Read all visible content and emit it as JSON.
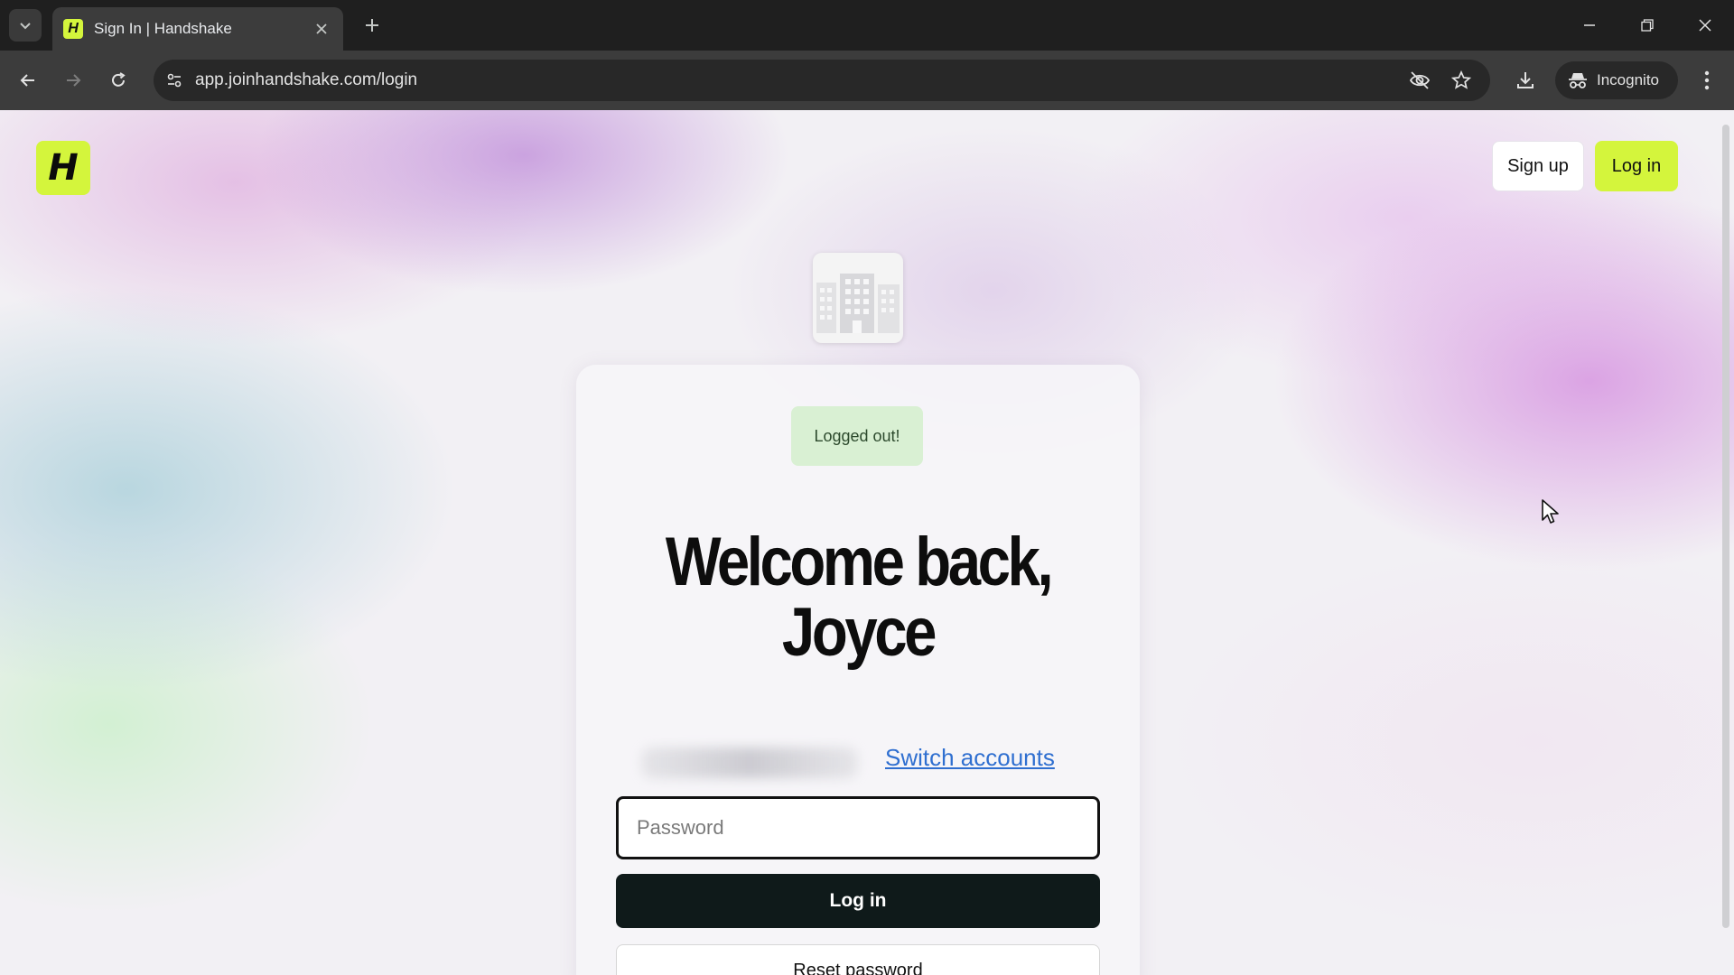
{
  "browser": {
    "tab_title": "Sign In | Handshake",
    "tab_favicon_letter": "H",
    "url": "app.joinhandshake.com/login",
    "incognito_label": "Incognito"
  },
  "header": {
    "logo_letter": "H",
    "signup_label": "Sign up",
    "login_label": "Log in"
  },
  "card": {
    "toast": "Logged out!",
    "welcome_line1": "Welcome back,",
    "welcome_line2": "Joyce",
    "switch_accounts": "Switch accounts",
    "password_placeholder": "Password",
    "login_button": "Log in",
    "reset_button": "Reset password"
  },
  "colors": {
    "brand_lime": "#d4f53c",
    "primary_button": "#0f1a1a",
    "link": "#2f6fd0",
    "toast_bg": "#d9f0d3"
  },
  "icons": [
    "tab-search-icon",
    "close-icon",
    "plus-icon",
    "minimize-icon",
    "restore-icon",
    "window-close-icon",
    "back-icon",
    "forward-icon",
    "reload-icon",
    "site-settings-icon",
    "eye-off-icon",
    "star-icon",
    "download-icon",
    "incognito-icon",
    "more-vert-icon",
    "building-icon",
    "cursor-icon"
  ]
}
